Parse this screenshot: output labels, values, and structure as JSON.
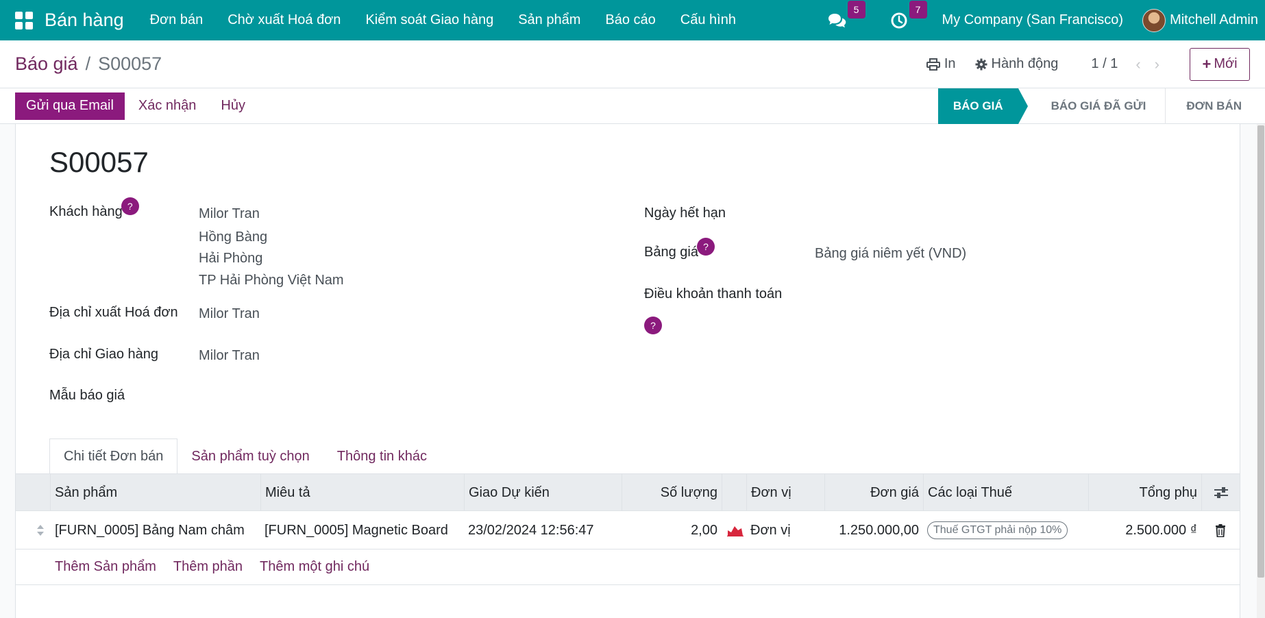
{
  "navbar": {
    "app_name": "Bán hàng",
    "menu": [
      "Đơn bán",
      "Chờ xuất Hoá đơn",
      "Kiểm soát Giao hàng",
      "Sản phẩm",
      "Báo cáo",
      "Cấu hình"
    ],
    "messages_count": "5",
    "activities_count": "7",
    "company": "My Company (San Francisco)",
    "user": "Mitchell Admin"
  },
  "control": {
    "breadcrumb_parent": "Báo giá",
    "breadcrumb_sep": "/",
    "breadcrumb_current": "S00057",
    "print_label": "In",
    "action_label": "Hành động",
    "pager": "1 / 1",
    "new_label": "Mới"
  },
  "statusbar": {
    "send_email": "Gửi qua Email",
    "confirm": "Xác nhận",
    "cancel": "Hủy",
    "stages": [
      "BÁO GIÁ",
      "BÁO GIÁ ĐÃ GỬI",
      "ĐƠN BÁN"
    ],
    "active_stage": "BÁO GIÁ"
  },
  "form": {
    "title": "S00057",
    "customer_label": "Khách hàng",
    "customer_name": "Milor Tran",
    "customer_addr1": "Hồng Bàng",
    "customer_addr2": "Hải Phòng",
    "customer_addr3": "TP Hải Phòng Việt Nam",
    "invoice_addr_label": "Địa chỉ xuất Hoá đơn",
    "invoice_addr": "Milor Tran",
    "delivery_addr_label": "Địa chỉ Giao hàng",
    "delivery_addr": "Milor Tran",
    "template_label": "Mẫu báo giá",
    "expiry_label": "Ngày hết hạn",
    "pricelist_label": "Bảng giá",
    "pricelist": "Bảng giá niêm yết (VND)",
    "payment_terms_label": "Điều khoản thanh toán",
    "help": "?"
  },
  "notebook": {
    "tabs": [
      "Chi tiết Đơn bán",
      "Sản phẩm tuỳ chọn",
      "Thông tin khác"
    ]
  },
  "lines": {
    "headers": {
      "product": "Sản phẩm",
      "description": "Miêu tả",
      "delivery": "Giao Dự kiến",
      "qty": "Số lượng",
      "uom": "Đơn vị",
      "price": "Đơn giá",
      "taxes": "Các loại Thuế",
      "subtotal": "Tổng phụ"
    },
    "rows": [
      {
        "product": "[FURN_0005] Bảng Nam châm",
        "description": "[FURN_0005] Magnetic Board",
        "delivery": "23/02/2024 12:56:47",
        "qty": "2,00",
        "uom": "Đơn vị",
        "price": "1.250.000,00",
        "tax": "Thuế GTGT phải nộp 10%",
        "subtotal": "2.500.000 ₫"
      }
    ],
    "add_product": "Thêm Sản phẩm",
    "add_section": "Thêm phần",
    "add_note": "Thêm một ghi chú"
  },
  "colors": {
    "navbar": "#00969b",
    "primary": "#8b1a7d",
    "link": "#71295f"
  }
}
